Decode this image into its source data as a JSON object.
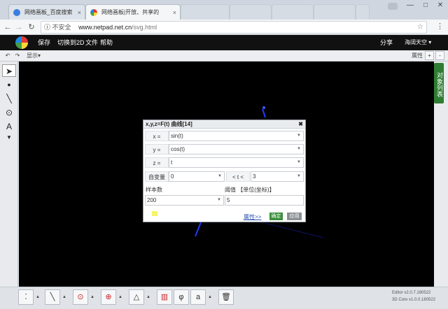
{
  "browser": {
    "tabs": [
      {
        "title": "网络画板_百度搜索",
        "close": "×"
      },
      {
        "title": "网络画板|开放、共享的",
        "close": "×"
      }
    ],
    "window_controls": {
      "minimize": "—",
      "maximize": "□",
      "close": "✕"
    },
    "insecure_label": "不安全",
    "url_host": "www.netpad.net.cn",
    "url_path": "/svg.html"
  },
  "app": {
    "menu": [
      "保存",
      "切换到2D",
      "文件",
      "帮助"
    ],
    "share": "分享",
    "user": "海阔天空 ▾"
  },
  "editor_toolbar": {
    "display": "显示▾",
    "properties": "属性",
    "zoom_in": "+",
    "zoom_out": "-"
  },
  "object_list": "对象列表",
  "dialog": {
    "title": "x,y,z=F(t) 曲线[14]",
    "close": "✖",
    "x_label": "x =",
    "x_value": "sin(t)",
    "y_label": "y =",
    "y_value": "cos(t)",
    "z_label": "z =",
    "z_value": "t",
    "var_label": "自变量",
    "t_min": "0",
    "t_range_label": "< t <",
    "t_max": "3",
    "samples_label": "样本数",
    "samples_value": "200",
    "threshold_label": "阈值 【单位(坐标)】",
    "threshold_value": "5",
    "properties_link": "属性>>",
    "ok": "确定",
    "apply": "应用"
  },
  "version": {
    "editor": "Editor v2.0.7.180522",
    "core": "3D Core v1.0.0.180522"
  }
}
